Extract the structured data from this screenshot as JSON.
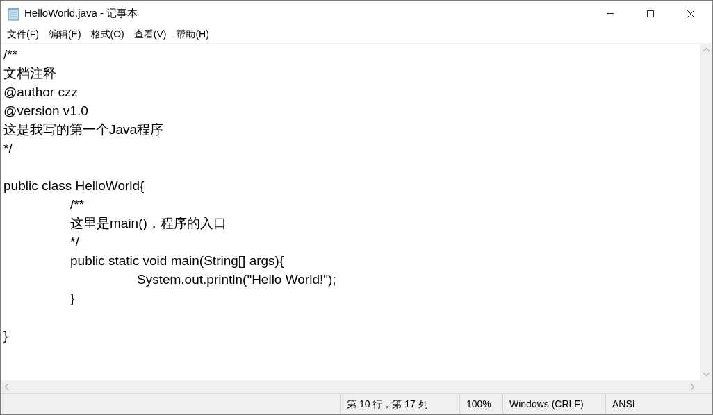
{
  "window": {
    "title": "HelloWorld.java - 记事本"
  },
  "menu": [
    "文件(F)",
    "编辑(E)",
    "格式(O)",
    "查看(V)",
    "帮助(H)"
  ],
  "editor": {
    "text": "/**\n文档注释\n@author czz\n@version v1.0\n这是我写的第一个Java程序\n*/\n\npublic class HelloWorld{\n\t/**\n\t这里是main()，程序的入口\n\t*/\n\tpublic static void main(String[] args){\n\t\tSystem.out.println(\"Hello World!\");\n\t}\n\n}"
  },
  "status_bar": [
    "第 10 行，第 17 列",
    "100%",
    "Windows (CRLF)",
    "ANSI"
  ]
}
